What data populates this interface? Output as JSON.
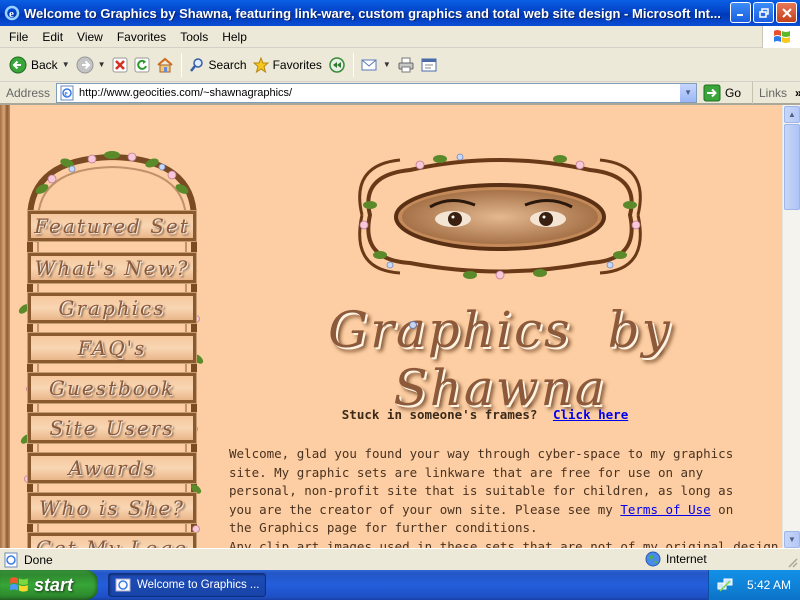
{
  "window": {
    "title": "Welcome to Graphics by Shawna, featuring link-ware, custom graphics and total web site design - Microsoft Int..."
  },
  "menu": [
    "File",
    "Edit",
    "View",
    "Favorites",
    "Tools",
    "Help"
  ],
  "toolbar": {
    "back": "Back",
    "search": "Search",
    "favorites": "Favorites"
  },
  "address": {
    "label": "Address",
    "url": "http://www.geocities.com/~shawnagraphics/",
    "go": "Go",
    "links": "Links"
  },
  "page": {
    "nav": [
      "Featured Set",
      "What's New?",
      "Graphics",
      "FAQ's",
      "Guestbook",
      "Site Users",
      "Awards",
      "Who is She?",
      "Get My Logo"
    ],
    "site_title": "Graphics by Shawna",
    "frames_text": "Stuck in someone's frames?",
    "frames_link": "Click here",
    "welcome_before": "Welcome, glad you found your way through cyber-space to my graphics site.  My graphic sets are linkware that are free for use on any personal, non-profit site that is suitable for children, as long as you are the creator of your own site.  Please see my ",
    "welcome_link": "Terms of Use",
    "welcome_after": " on the Graphics page for further conditions.",
    "clip_text": "Any clip art images used in these sets that are not of my original design are from"
  },
  "status": {
    "text": "Done",
    "zone": "Internet"
  },
  "taskbar": {
    "start": "start",
    "task": "Welcome to Graphics ...",
    "clock": "5:42 AM"
  }
}
